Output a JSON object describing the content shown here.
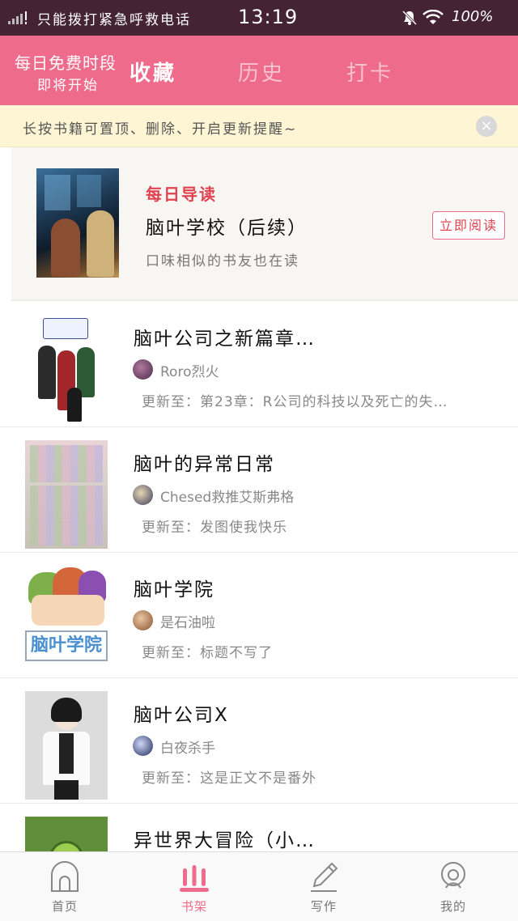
{
  "status_bar": {
    "carrier": "只能拨打紧急呼救电话",
    "time": "13:19",
    "battery": "100%"
  },
  "header": {
    "promo_line1": "每日免费时段",
    "promo_line2": "即将开始",
    "tabs": [
      {
        "label": "收藏",
        "active": true
      },
      {
        "label": "历史",
        "active": false
      },
      {
        "label": "打卡",
        "active": false
      }
    ]
  },
  "tip": {
    "text": "长按书籍可置顶、删除、开启更新提醒~",
    "close_icon": "close-icon"
  },
  "daily": {
    "tag": "每日导读",
    "title": "脑叶学校（后续）",
    "desc": "口味相似的书友也在读",
    "button": "立即阅读"
  },
  "books": [
    {
      "title": "脑叶公司之新篇章…",
      "author": "Roro烈火",
      "update": "更新至：第23章：R公司的科技以及死亡的失…"
    },
    {
      "title": "脑叶的异常日常",
      "author": "Chesed救推艾斯弗格",
      "update": "更新至：发图使我快乐"
    },
    {
      "title": "脑叶学院",
      "author": "是石油啦",
      "update": "更新至：标题不写了",
      "cover_text": "脑叶学院"
    },
    {
      "title": "脑叶公司X",
      "author": "白夜杀手",
      "update": "更新至：这是正文不是番外"
    },
    {
      "title": "异世界大冒险（小…",
      "author": "",
      "update": ""
    }
  ],
  "bottom_nav": [
    {
      "label": "首页",
      "icon": "home-icon",
      "active": false
    },
    {
      "label": "书架",
      "icon": "bookshelf-icon",
      "active": true
    },
    {
      "label": "写作",
      "icon": "pen-icon",
      "active": false
    },
    {
      "label": "我的",
      "icon": "profile-icon",
      "active": false
    }
  ],
  "colors": {
    "accent": "#ef6b8b",
    "status_bar": "#442334",
    "tip_bg": "#fdf5d4",
    "highlight_red": "#e0424f"
  }
}
